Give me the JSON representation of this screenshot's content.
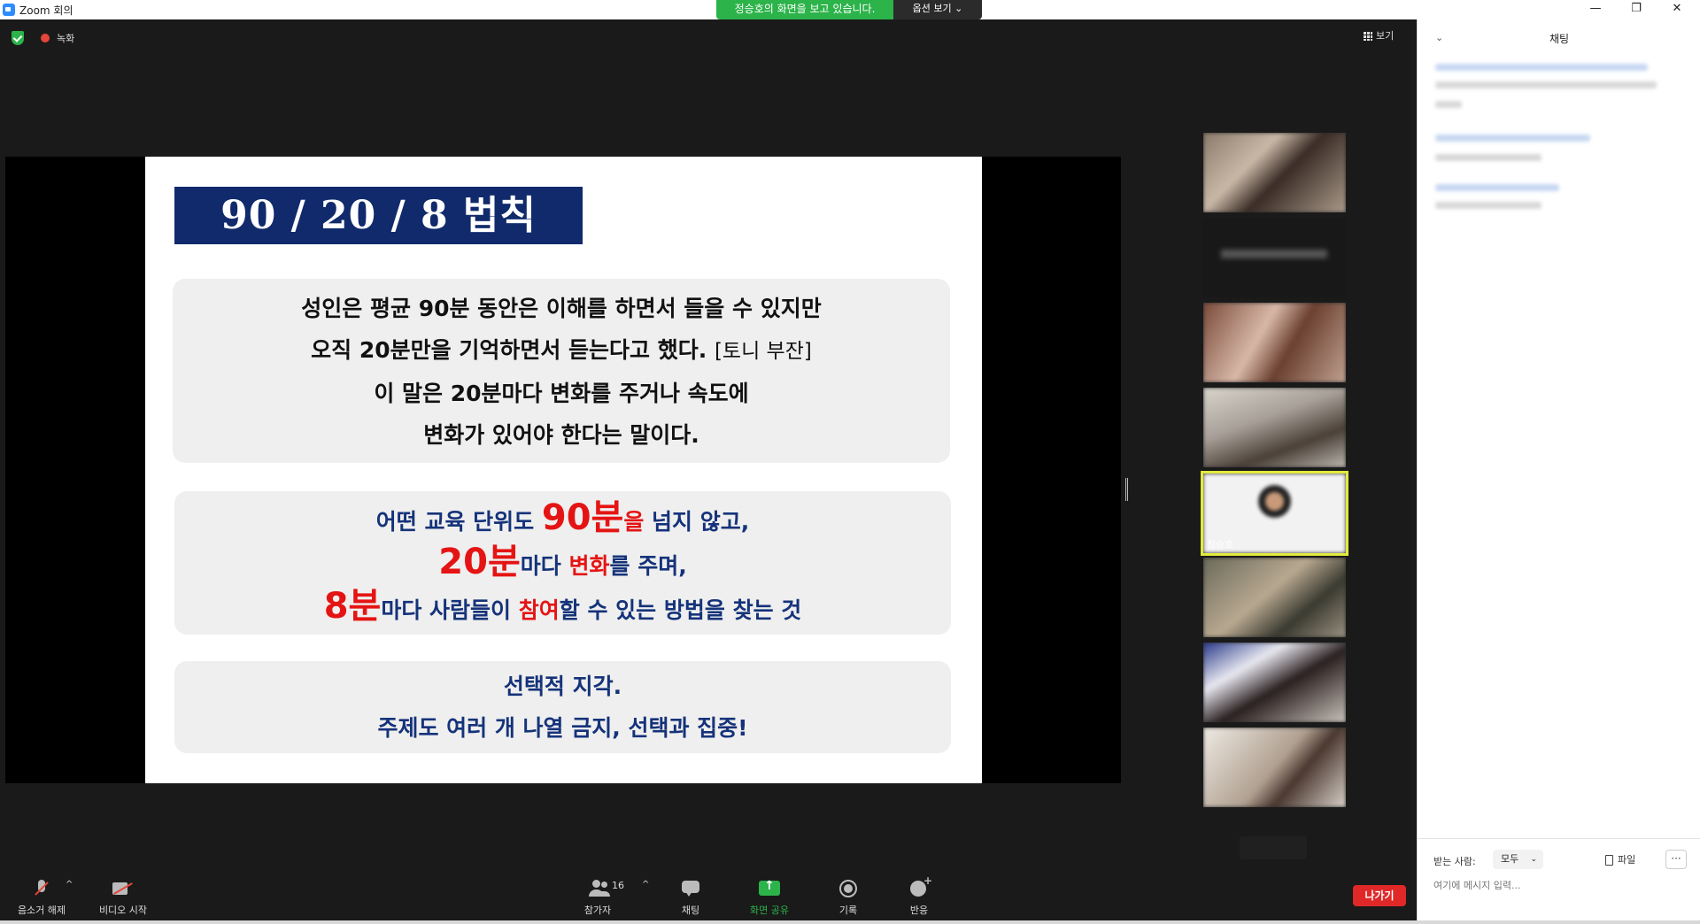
{
  "window": {
    "title": "Zoom 회의",
    "minimize_glyph": "—",
    "maximize_glyph": "❐",
    "close_glyph": "✕"
  },
  "share_banner": {
    "text": "정승호의 화면을 보고 있습니다.",
    "options_label": "옵션 보기 ⌄"
  },
  "meeting_status": {
    "record_label": "녹화",
    "view_label": "보기"
  },
  "slide": {
    "title": "90 / 20 / 8 법칙",
    "box1": {
      "line1": "성인은 평균 90분 동안은 이해를 하면서 들을 수 있지만",
      "line2": "오직 20분만을 기억하면서 듣는다고 했다.",
      "line2_note": "[토니 부잔]",
      "line3": "이 말은 20분마다 변화를 주거나 속도에",
      "line4": "변화가 있어야 한다는 말이다."
    },
    "box2": {
      "l1_a": "어떤 교육 단위도 ",
      "l1_big": "90분",
      "l1_red": "을",
      "l1_b": " 넘지 않고,",
      "l2_big": "20분",
      "l2_a": "마다 ",
      "l2_red": "변화",
      "l2_b": "를 주며,",
      "l3_big": "8분",
      "l3_a": "마다 사람들이 ",
      "l3_red": "참여",
      "l3_b": "할 수 있는 방법을 찾는 것"
    },
    "box3": {
      "line1": "선택적 지각.",
      "line2": "주제도 여러 개 나열 금지, 선택과 집중!"
    }
  },
  "gallery": {
    "active_name": "정승호"
  },
  "toolbar": {
    "mute_label": "음소거 해제",
    "video_label": "비디오 시작",
    "participants_label": "참가자",
    "participants_count": "16",
    "chat_label": "채팅",
    "share_label": "화면 공유",
    "record_label": "기록",
    "reactions_label": "반응",
    "leave_label": "나가기",
    "caret": "^"
  },
  "chat": {
    "title": "채팅",
    "collapse_glyph": "⌄",
    "to_label": "받는 사람:",
    "to_value": "모두",
    "file_label": "파일",
    "more_glyph": "···",
    "input_placeholder": "여기에 메시지 입력..."
  },
  "colors": {
    "share_green": "#2cb34a",
    "slide_navy": "#102a6c",
    "slide_red": "#e51414",
    "active_tile_border": "#e2ea3c",
    "leave_red": "#e02828"
  }
}
